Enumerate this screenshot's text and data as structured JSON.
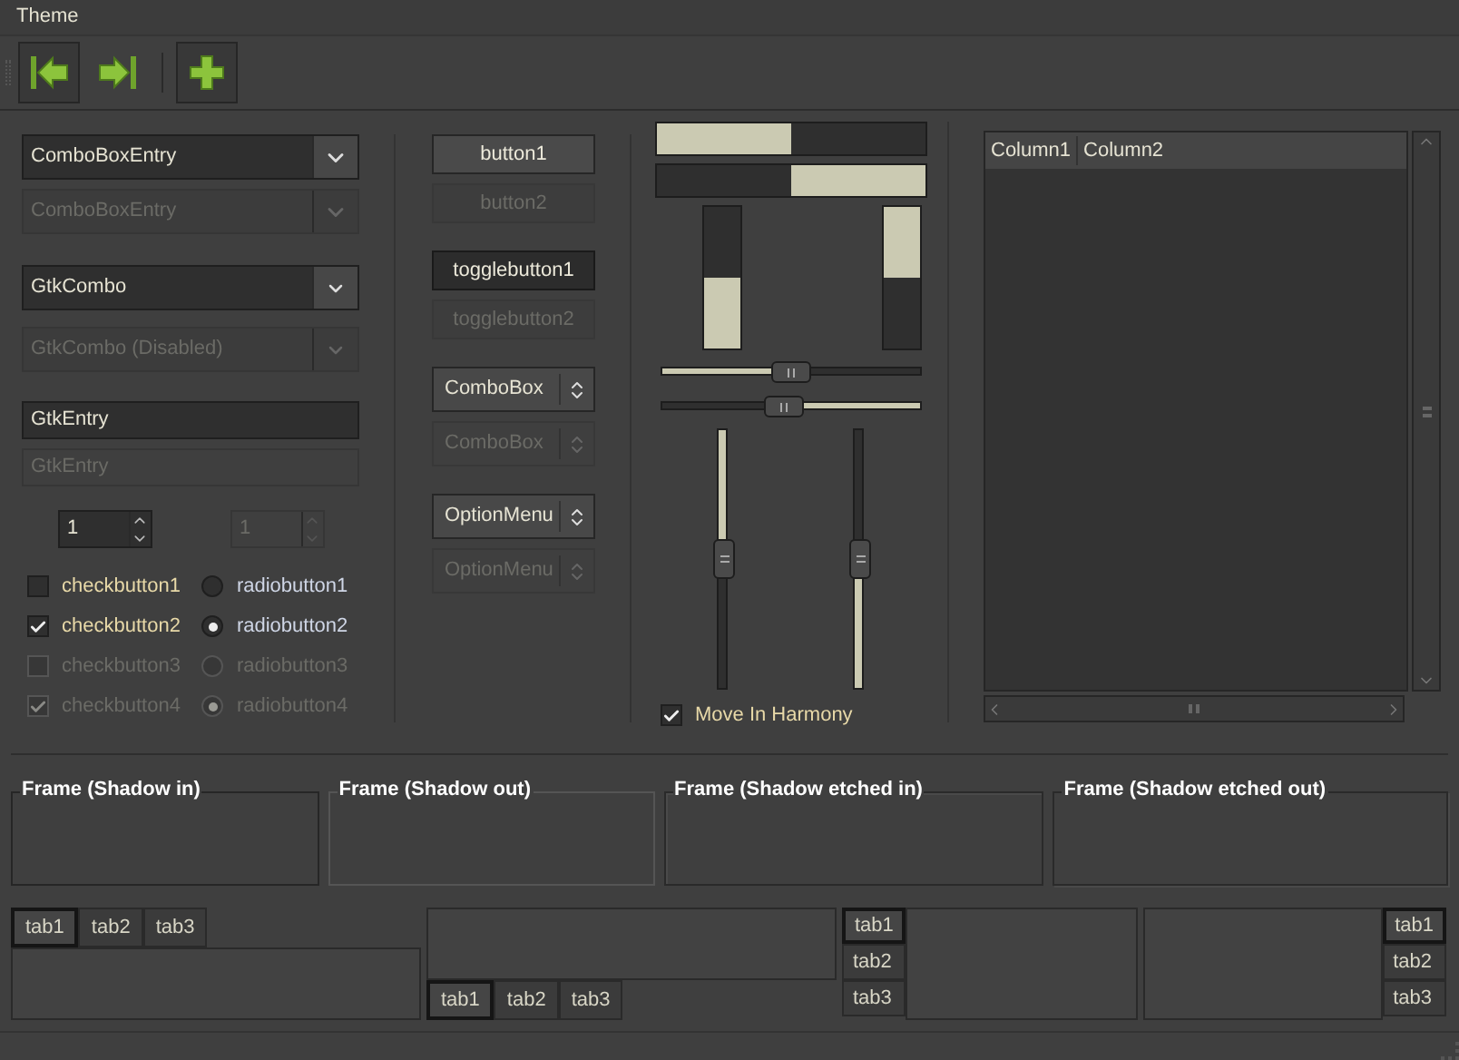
{
  "menubar": [
    "Theme"
  ],
  "toolbar": [
    {
      "kind": "first",
      "relief": true
    },
    {
      "kind": "last",
      "relief": false
    },
    {
      "kind": "separator"
    },
    {
      "kind": "add",
      "relief": true
    }
  ],
  "combos": [
    {
      "kind": "entry",
      "text": "ComboBoxEntry",
      "disabled": false
    },
    {
      "kind": "entry",
      "text": "ComboBoxEntry",
      "disabled": true
    },
    {
      "kind": "combo",
      "text": "GtkCombo",
      "disabled": false
    },
    {
      "kind": "combo",
      "text": "GtkCombo (Disabled)",
      "disabled": true
    }
  ],
  "entries": [
    {
      "text": "GtkEntry",
      "disabled": false
    },
    {
      "text": "GtkEntry",
      "disabled": true
    }
  ],
  "spinners": [
    {
      "value": "1",
      "disabled": false
    },
    {
      "value": "1",
      "disabled": true
    }
  ],
  "checkbuttons": [
    {
      "label": "checkbutton1",
      "checked": false,
      "disabled": false
    },
    {
      "label": "checkbutton2",
      "checked": true,
      "disabled": false
    },
    {
      "label": "checkbutton3",
      "checked": false,
      "disabled": true
    },
    {
      "label": "checkbutton4",
      "checked": true,
      "disabled": true
    }
  ],
  "radiobuttons": [
    {
      "label": "radiobutton1",
      "selected": false,
      "disabled": false
    },
    {
      "label": "radiobutton2",
      "selected": true,
      "disabled": false
    },
    {
      "label": "radiobutton3",
      "selected": false,
      "disabled": true
    },
    {
      "label": "radiobutton4",
      "selected": true,
      "disabled": true
    }
  ],
  "buttons": [
    {
      "label": "button1",
      "active": false,
      "disabled": false
    },
    {
      "label": "button2",
      "active": false,
      "disabled": true
    },
    {
      "label": "togglebutton1",
      "active": true,
      "disabled": false
    },
    {
      "label": "togglebutton2",
      "active": false,
      "disabled": true
    }
  ],
  "combo_boxes": [
    {
      "label": "ComboBox",
      "disabled": false
    },
    {
      "label": "ComboBox",
      "disabled": true
    },
    {
      "label": "OptionMenu",
      "disabled": false
    },
    {
      "label": "OptionMenu",
      "disabled": true
    }
  ],
  "progress_bars": [
    {
      "kind": "horizontal",
      "inverted": false,
      "level": 0.5
    },
    {
      "kind": "horizontal",
      "inverted": true,
      "level": 0.5
    },
    {
      "kind": "vertical",
      "inverted": false,
      "level": 0.5
    },
    {
      "kind": "vertical",
      "inverted": true,
      "level": 0.5
    }
  ],
  "scales": [
    {
      "kind": "horizontal",
      "inverted": false,
      "level": 0.5
    },
    {
      "kind": "horizontal",
      "inverted": true,
      "level": 0.47
    },
    {
      "kind": "vertical",
      "inverted": false,
      "level": 0.5
    },
    {
      "kind": "vertical",
      "inverted": true,
      "level": 0.5
    }
  ],
  "harmony": {
    "label": "Move In Harmony",
    "checked": true
  },
  "tree": {
    "columns": [
      "Column1",
      "Column2"
    ]
  },
  "frames": [
    {
      "label": "Frame (Shadow in)",
      "kind": "in"
    },
    {
      "label": "Frame (Shadow out)",
      "kind": "out"
    },
    {
      "label": "Frame (Shadow etched in)",
      "kind": "etched_in"
    },
    {
      "label": "Frame (Shadow etched out)",
      "kind": "etched_out"
    }
  ],
  "notebooks": [
    {
      "kind": "top",
      "tabs": [
        {
          "label": "tab1",
          "selected": true
        },
        {
          "label": "tab2",
          "selected": false
        },
        {
          "label": "tab3",
          "selected": false
        }
      ]
    },
    {
      "kind": "bottom",
      "tabs": [
        {
          "label": "tab1",
          "selected": true
        },
        {
          "label": "tab2",
          "selected": false
        },
        {
          "label": "tab3",
          "selected": false
        }
      ]
    },
    {
      "kind": "left",
      "tabs": [
        {
          "label": "tab1",
          "selected": true
        },
        {
          "label": "tab2",
          "selected": false
        },
        {
          "label": "tab3",
          "selected": false
        }
      ]
    },
    {
      "kind": "right",
      "tabs": [
        {
          "label": "tab1",
          "selected": true
        },
        {
          "label": "tab2",
          "selected": false
        },
        {
          "label": "tab3",
          "selected": false
        }
      ]
    }
  ]
}
